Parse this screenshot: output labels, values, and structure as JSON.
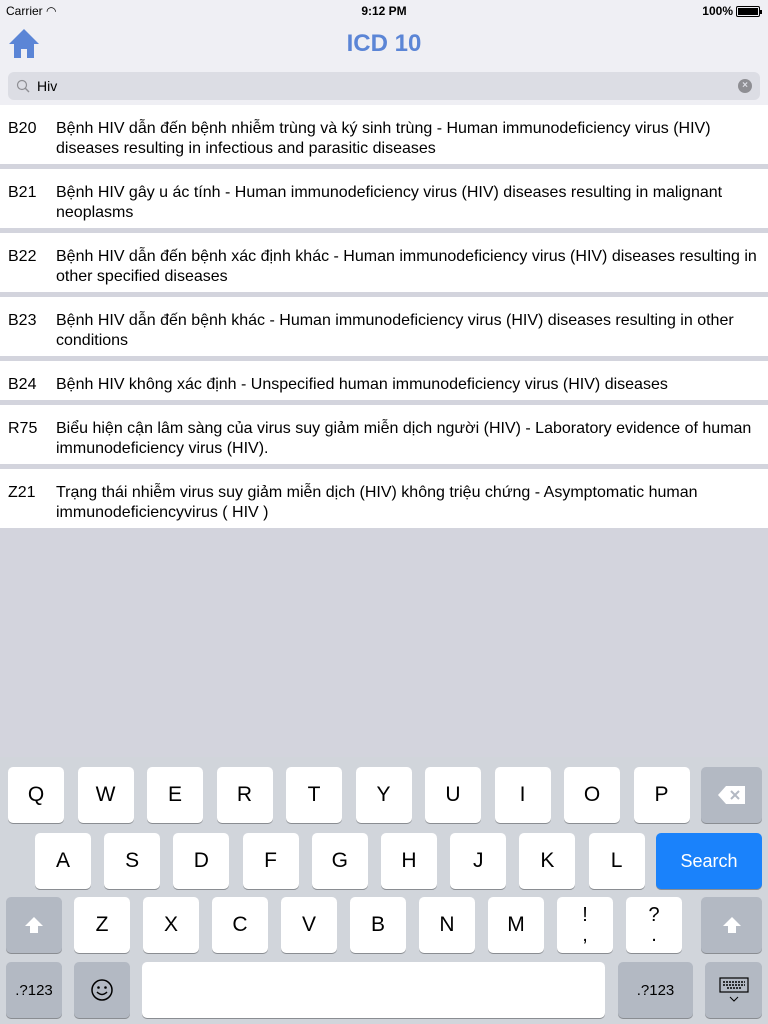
{
  "status_bar": {
    "carrier": "Carrier",
    "time": "9:12 PM",
    "battery": "100%"
  },
  "header": {
    "title": "ICD 10",
    "home_icon": "home-icon",
    "accent": "#5b85d6"
  },
  "search": {
    "value": "Hiv",
    "placeholder": ""
  },
  "results": [
    {
      "code": "B20",
      "description": "Bệnh HIV dẫn đến bệnh nhiễm trùng và ký sinh trùng  - Human immunodeficiency virus (HIV) diseases resulting in infectious and parasitic diseases"
    },
    {
      "code": "B21",
      "description": "Bệnh HIV gây u ác tính  - Human immunodeficiency virus (HIV) diseases resulting in malignant neoplasms"
    },
    {
      "code": "B22",
      "description": "Bệnh HIV dẫn đến bệnh xác định khác  - Human immunodeficiency virus (HIV) diseases resulting in other specified diseases"
    },
    {
      "code": "B23",
      "description": "Bệnh HIV dẫn đến bệnh khác  - Human immunodeficiency virus (HIV) diseases resulting in other conditions"
    },
    {
      "code": "B24",
      "description": "Bệnh HIV không xác định  - Unspecified human immunodeficiency virus (HIV) diseases"
    },
    {
      "code": "R75",
      "description": "Biểu hiện cận lâm sàng của virus suy giảm miễn dịch người (HIV)  - Laboratory evidence of human immunodeficiency virus (HIV)."
    },
    {
      "code": "Z21",
      "description": "Trạng thái nhiễm virus suy giảm miễn dịch (HIV) không triệu chứng  - Asymptomatic human immunodeficiencyvirus ( HIV )"
    }
  ],
  "keyboard": {
    "row1": [
      "Q",
      "W",
      "E",
      "R",
      "T",
      "Y",
      "U",
      "I",
      "O",
      "P"
    ],
    "row2": [
      "A",
      "S",
      "D",
      "F",
      "G",
      "H",
      "J",
      "K",
      "L"
    ],
    "row3": [
      "Z",
      "X",
      "C",
      "V",
      "B",
      "N",
      "M"
    ],
    "punct": [
      {
        "top": "!",
        "bottom": ","
      },
      {
        "top": "?",
        "bottom": "."
      }
    ],
    "search_label": "Search",
    "numbers_label": ".?123",
    "search_color": "#1a82fb"
  }
}
